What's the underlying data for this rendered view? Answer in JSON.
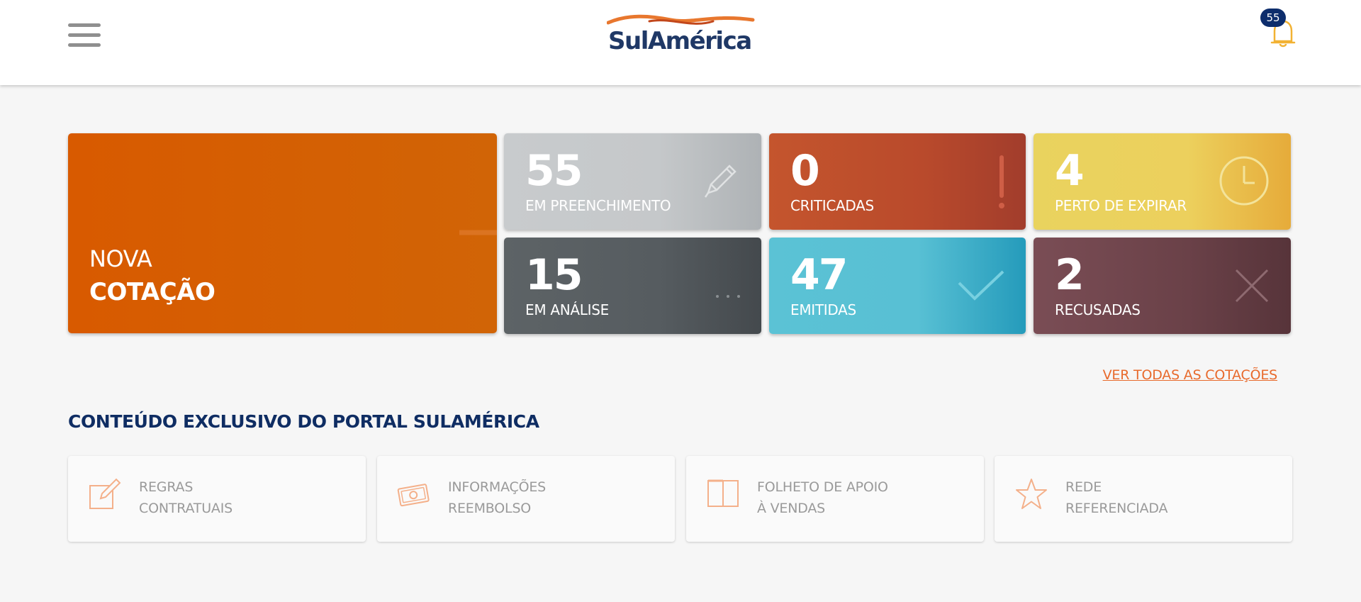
{
  "header": {
    "logo_text": "SulAmérica",
    "notification_count": "55"
  },
  "nova": {
    "line1": "NOVA",
    "line2": "COTAÇÃO"
  },
  "cards": [
    {
      "count": "55",
      "label": "EM PREENCHIMENTO",
      "icon": "pencil-icon"
    },
    {
      "count": "0",
      "label": "CRITICADAS",
      "icon": "exclamation-icon"
    },
    {
      "count": "4",
      "label": "PERTO DE EXPIRAR",
      "icon": "clock-icon"
    },
    {
      "count": "15",
      "label": "EM ANÁLISE",
      "icon": "ellipsis-icon"
    },
    {
      "count": "47",
      "label": "EMITIDAS",
      "icon": "check-icon"
    },
    {
      "count": "2",
      "label": "RECUSADAS",
      "icon": "x-icon"
    }
  ],
  "ver_todas": "VER TODAS AS COTAÇÕES",
  "section_title": "CONTEÚDO EXCLUSIVO DO PORTAL SULAMÉRICA",
  "tiles": [
    {
      "line1": "REGRAS",
      "line2": "CONTRATUAIS",
      "icon": "edit-document-icon"
    },
    {
      "line1": "INFORMAÇÕES",
      "line2": "REEMBOLSO",
      "icon": "money-icon"
    },
    {
      "line1": "FOLHETO DE APOIO",
      "line2": "À VENDAS",
      "icon": "book-icon"
    },
    {
      "line1": "REDE",
      "line2": "REFERENCIADA",
      "icon": "star-icon"
    }
  ],
  "colors": {
    "accent_orange": "#d85a00",
    "brand_navy": "#1f3866",
    "link_orange": "#e86a2c",
    "icon_peach": "#f4b08a"
  }
}
